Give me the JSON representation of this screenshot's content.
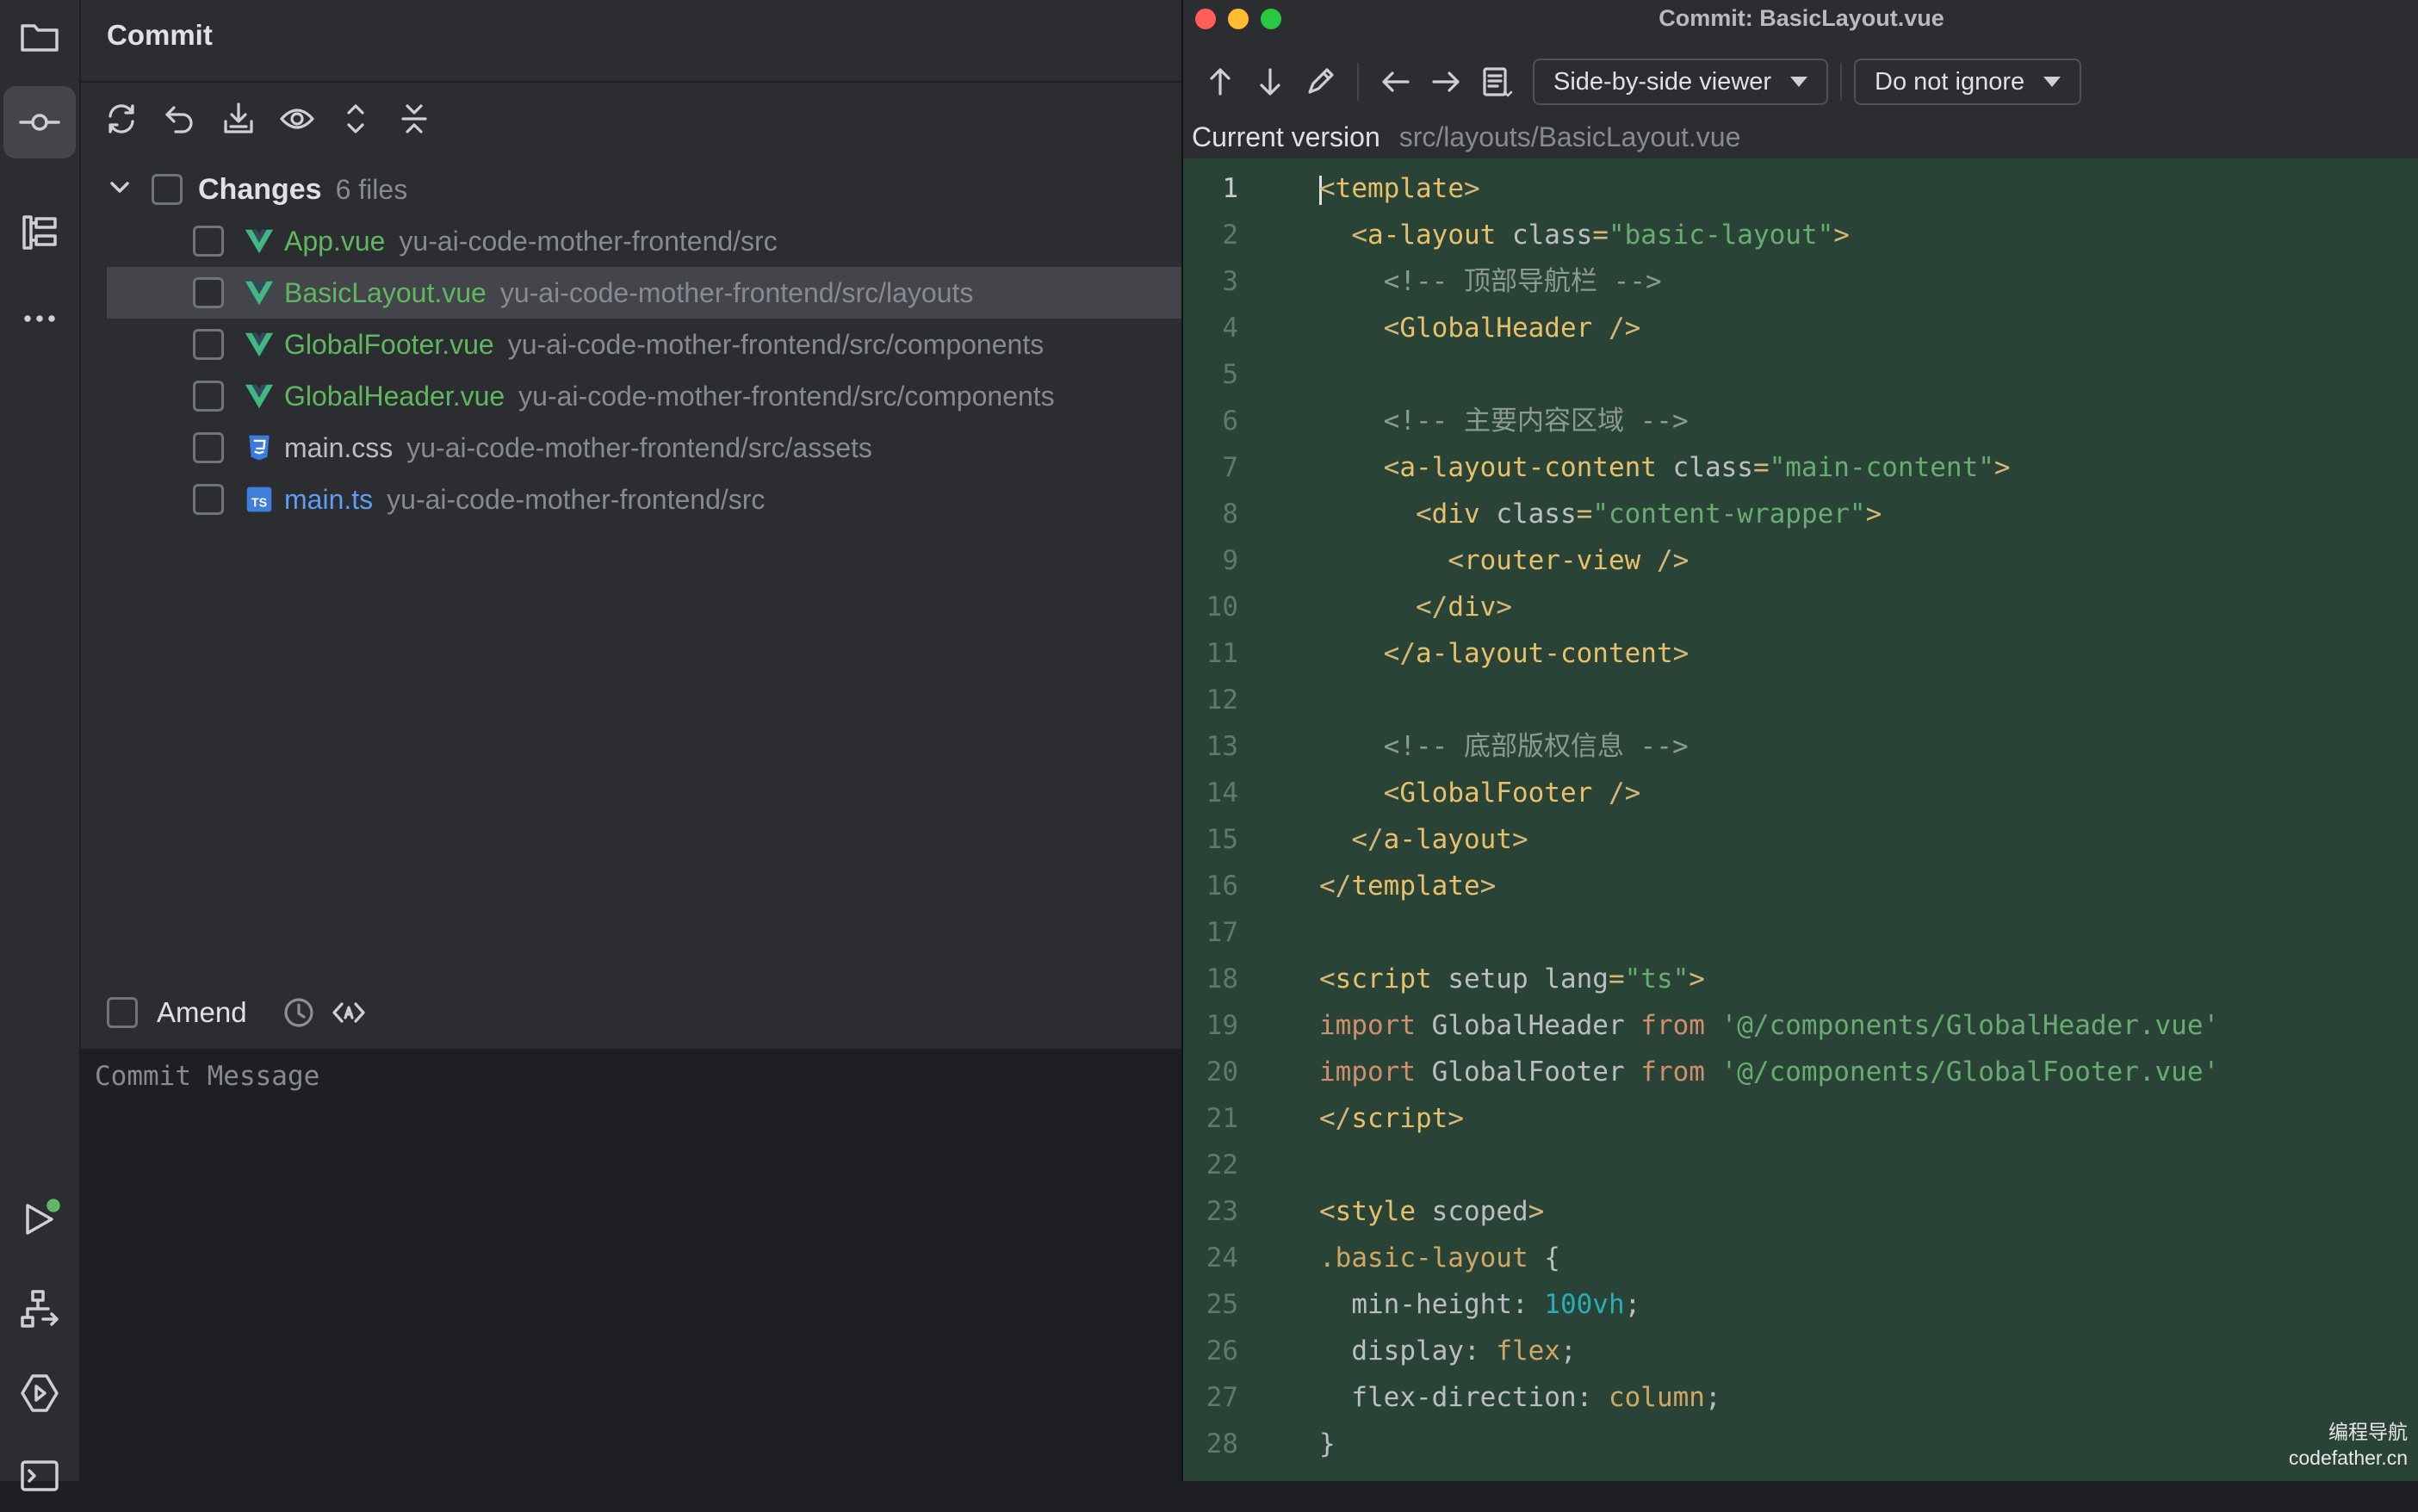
{
  "colors": {
    "app_bg": "#1e1f22",
    "panel_bg": "#2b2d30",
    "editor_added_bg": "#294436",
    "vue_green": "#5fb85f",
    "new_file_blue": "#5e9cf5",
    "status_green": "#5fb865"
  },
  "activity_bar": {
    "icons": [
      "folder-icon",
      "commit-icon",
      "structure-icon",
      "more-icon",
      "run-icon",
      "git-branch-icon",
      "services-icon",
      "terminal-icon"
    ]
  },
  "commit_panel": {
    "title": "Commit",
    "toolbar_icons": [
      "refresh-icon",
      "rollback-icon",
      "shelve-icon",
      "preview-diff-icon",
      "expand-all-icon",
      "collapse-all-icon"
    ],
    "changes_label": "Changes",
    "changes_count": "6 files",
    "files": [
      {
        "name": "App.vue",
        "path": "yu-ai-code-mother-frontend/src",
        "icon": "vue-file-icon",
        "status": "added-vue"
      },
      {
        "name": "BasicLayout.vue",
        "path": "yu-ai-code-mother-frontend/src/layouts",
        "icon": "vue-file-icon",
        "status": "added-vue"
      },
      {
        "name": "GlobalFooter.vue",
        "path": "yu-ai-code-mother-frontend/src/components",
        "icon": "vue-file-icon",
        "status": "added-vue"
      },
      {
        "name": "GlobalHeader.vue",
        "path": "yu-ai-code-mother-frontend/src/components",
        "icon": "vue-file-icon",
        "status": "added-vue"
      },
      {
        "name": "main.css",
        "path": "yu-ai-code-mother-frontend/src/assets",
        "icon": "css-file-icon",
        "status": "unchanged"
      },
      {
        "name": "main.ts",
        "path": "yu-ai-code-mother-frontend/src",
        "icon": "ts-file-icon",
        "status": "modified"
      }
    ],
    "amend_label": "Amend",
    "commit_message_placeholder": "Commit Message"
  },
  "diff_window": {
    "title": "Commit: BasicLayout.vue",
    "viewer_mode": "Side-by-side viewer",
    "whitespace_mode": "Do not ignore",
    "version_label": "Current version",
    "version_path": "src/layouts/BasicLayout.vue",
    "current_line": 1,
    "code_lines": [
      [
        [
          "t-punct",
          "<"
        ],
        [
          "t-tag",
          "template"
        ],
        [
          "t-punct",
          ">"
        ]
      ],
      [
        [
          "",
          "  "
        ],
        [
          "t-punct",
          "<"
        ],
        [
          "t-tag",
          "a-layout"
        ],
        [
          "t-attr",
          " class"
        ],
        [
          "t-punct",
          "="
        ],
        [
          "t-str",
          "\"basic-layout\""
        ],
        [
          "t-punct",
          ">"
        ]
      ],
      [
        [
          "",
          "    "
        ],
        [
          "t-cmt",
          "<!-- 顶部导航栏 -->"
        ]
      ],
      [
        [
          "",
          "    "
        ],
        [
          "t-punct",
          "<"
        ],
        [
          "t-tag",
          "GlobalHeader"
        ],
        [
          "t-punct",
          " />"
        ]
      ],
      [],
      [
        [
          "",
          "    "
        ],
        [
          "t-cmt",
          "<!-- 主要内容区域 -->"
        ]
      ],
      [
        [
          "",
          "    "
        ],
        [
          "t-punct",
          "<"
        ],
        [
          "t-tag",
          "a-layout-content"
        ],
        [
          "t-attr",
          " class"
        ],
        [
          "t-punct",
          "="
        ],
        [
          "t-str",
          "\"main-content\""
        ],
        [
          "t-punct",
          ">"
        ]
      ],
      [
        [
          "",
          "      "
        ],
        [
          "t-punct",
          "<"
        ],
        [
          "t-tag",
          "div"
        ],
        [
          "t-attr",
          " class"
        ],
        [
          "t-punct",
          "="
        ],
        [
          "t-str",
          "\"content-wrapper\""
        ],
        [
          "t-punct",
          ">"
        ]
      ],
      [
        [
          "",
          "        "
        ],
        [
          "t-punct",
          "<"
        ],
        [
          "t-tag",
          "router-view"
        ],
        [
          "t-punct",
          " />"
        ]
      ],
      [
        [
          "",
          "      "
        ],
        [
          "t-punct",
          "</"
        ],
        [
          "t-tag",
          "div"
        ],
        [
          "t-punct",
          ">"
        ]
      ],
      [
        [
          "",
          "    "
        ],
        [
          "t-punct",
          "</"
        ],
        [
          "t-tag",
          "a-layout-content"
        ],
        [
          "t-punct",
          ">"
        ]
      ],
      [],
      [
        [
          "",
          "    "
        ],
        [
          "t-cmt",
          "<!-- 底部版权信息 -->"
        ]
      ],
      [
        [
          "",
          "    "
        ],
        [
          "t-punct",
          "<"
        ],
        [
          "t-tag",
          "GlobalFooter"
        ],
        [
          "t-punct",
          " />"
        ]
      ],
      [
        [
          "",
          "  "
        ],
        [
          "t-punct",
          "</"
        ],
        [
          "t-tag",
          "a-layout"
        ],
        [
          "t-punct",
          ">"
        ]
      ],
      [
        [
          "t-punct",
          "</"
        ],
        [
          "t-tag",
          "template"
        ],
        [
          "t-punct",
          ">"
        ]
      ],
      [],
      [
        [
          "t-punct",
          "<"
        ],
        [
          "t-tag",
          "script"
        ],
        [
          "t-attr",
          " setup lang"
        ],
        [
          "t-punct",
          "="
        ],
        [
          "t-str",
          "\"ts\""
        ],
        [
          "t-punct",
          ">"
        ]
      ],
      [
        [
          "t-kw",
          "import"
        ],
        [
          "t-attr",
          " GlobalHeader "
        ],
        [
          "t-kw",
          "from"
        ],
        [
          "t-str",
          " '@/components/GlobalHeader.vue'"
        ]
      ],
      [
        [
          "t-kw",
          "import"
        ],
        [
          "t-attr",
          " GlobalFooter "
        ],
        [
          "t-kw",
          "from"
        ],
        [
          "t-str",
          " '@/components/GlobalFooter.vue'"
        ]
      ],
      [
        [
          "t-punct",
          "</"
        ],
        [
          "t-tag",
          "script"
        ],
        [
          "t-punct",
          ">"
        ]
      ],
      [],
      [
        [
          "t-punct",
          "<"
        ],
        [
          "t-tag",
          "style"
        ],
        [
          "t-attr",
          " scoped"
        ],
        [
          "t-punct",
          ">"
        ]
      ],
      [
        [
          "t-val",
          ".basic-layout"
        ],
        [
          "t-attr",
          " {"
        ]
      ],
      [
        [
          "t-attr",
          "  min-height: "
        ],
        [
          "t-num",
          "100vh"
        ],
        [
          "t-attr",
          ";"
        ]
      ],
      [
        [
          "t-attr",
          "  display: "
        ],
        [
          "t-val",
          "flex"
        ],
        [
          "t-attr",
          ";"
        ]
      ],
      [
        [
          "t-attr",
          "  flex-direction: "
        ],
        [
          "t-val",
          "column"
        ],
        [
          "t-attr",
          ";"
        ]
      ],
      [
        [
          "t-attr",
          "}"
        ]
      ]
    ]
  },
  "watermark": {
    "line1": "编程导航",
    "line2": "codefather.cn"
  }
}
